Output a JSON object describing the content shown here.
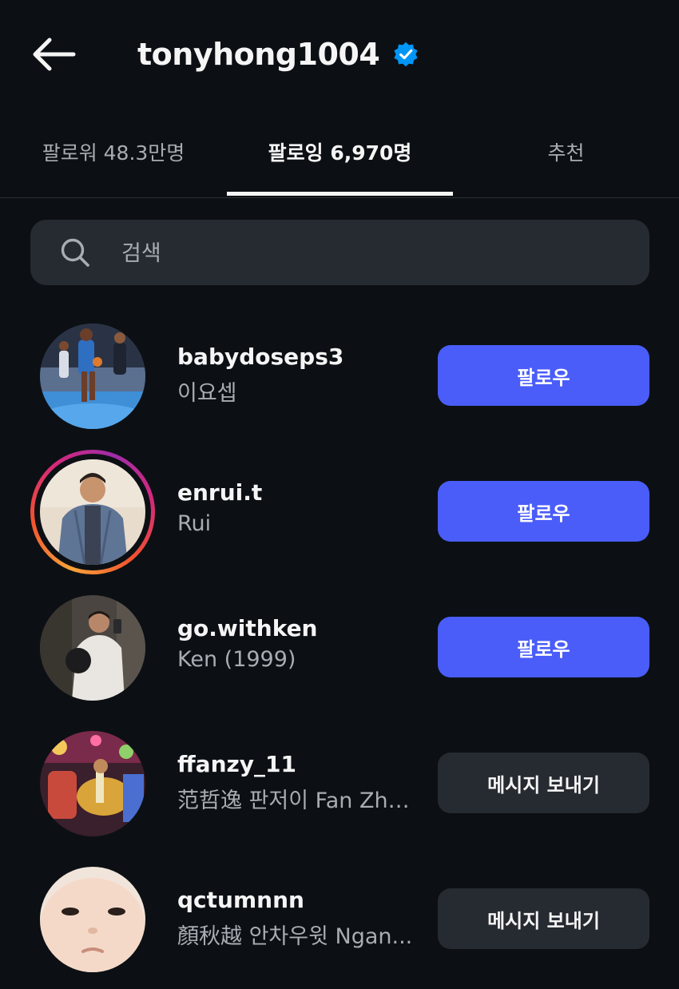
{
  "header": {
    "title": "tonyhong1004",
    "back_icon": "arrow-left-icon",
    "verified_icon": "verified-badge-icon",
    "verified_color": "#0095f6"
  },
  "tabs": [
    {
      "label": "팔로워 48.3만명",
      "active": false
    },
    {
      "label": "팔로잉 6,970명",
      "active": true
    },
    {
      "label": "추천",
      "active": false
    }
  ],
  "search": {
    "placeholder": "검색",
    "value": "",
    "icon": "search-icon"
  },
  "accounts": [
    {
      "username": "babydoseps3",
      "name": "이요셉",
      "button": "팔로우",
      "button_style": "primary",
      "has_story": false,
      "avatar_icon": "basketball-photo"
    },
    {
      "username": "enrui.t",
      "name": "Rui",
      "button": "팔로우",
      "button_style": "primary",
      "has_story": true,
      "avatar_icon": "person-photo"
    },
    {
      "username": "go.withken",
      "name": "Ken (1999)",
      "button": "팔로우",
      "button_style": "primary",
      "has_story": false,
      "avatar_icon": "mirror-selfie-photo"
    },
    {
      "username": "ffanzy_11",
      "name": "范哲逸 판저이 Fan Zhe...",
      "button": "메시지 보내기",
      "button_style": "secondary",
      "has_story": false,
      "avatar_icon": "carousel-photo"
    },
    {
      "username": "qctumnnn",
      "name": "顏秋越 안차우윗 Ngan...",
      "button": "메시지 보내기",
      "button_style": "secondary",
      "has_story": false,
      "avatar_icon": "baby-face-photo"
    }
  ],
  "colors": {
    "background": "#0c1014",
    "primary_button": "#4a5df9",
    "secondary_button": "#262a31",
    "muted_text": "#a8adb3"
  }
}
